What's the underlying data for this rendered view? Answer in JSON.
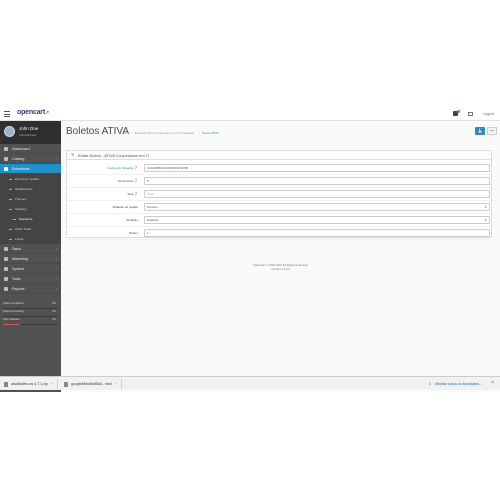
{
  "header": {
    "logo_text": "opencart",
    "logo_cart": "↗ ",
    "logout_label": "Logout"
  },
  "sidebar": {
    "user_name": "John Doe",
    "user_role": "Administrator",
    "menu": [
      {
        "label": "Dashboard",
        "icon": "dashboard-icon"
      },
      {
        "label": "Catalog",
        "icon": "tags-icon"
      },
      {
        "label": "Extensions",
        "icon": "puzzle-icon"
      }
    ],
    "submenu": [
      {
        "label": "Extension Installer"
      },
      {
        "label": "Modifications"
      },
      {
        "label": "Themes"
      },
      {
        "label": "Shipping"
      },
      {
        "label": "Payments"
      },
      {
        "label": "Order Totals"
      },
      {
        "label": "Feeds"
      }
    ],
    "menu2": [
      {
        "label": "Sales",
        "icon": "cart-icon"
      },
      {
        "label": "Marketing",
        "icon": "share-icon"
      },
      {
        "label": "System",
        "icon": "cog-icon"
      },
      {
        "label": "Tools",
        "icon": "wrench-icon"
      },
      {
        "label": "Reports",
        "icon": "bar-chart-icon"
      }
    ],
    "stats": [
      {
        "label": "Orders Completed",
        "pct": "0%",
        "value": 0,
        "color": "#5cb85c"
      },
      {
        "label": "Orders Processing",
        "pct": "0%",
        "value": 0,
        "color": "#f0ad4e"
      },
      {
        "label": "Other Statuses",
        "pct": "0%",
        "value": 0.3,
        "color": "#d9534f"
      }
    ]
  },
  "main": {
    "title": "Boletos ATIVA",
    "breadcrumb": [
      "Home",
      "/",
      "Extensão ATIVA Cooperados em TI (Unificadas)",
      "/",
      "Boleto ATIVA"
    ],
    "save_icon": "💾",
    "back_icon": "↩",
    "panel_title": "Editar Boleto - ATIVA Cooperados em TI",
    "fields": [
      {
        "label": "Código de Situação",
        "value": "1D4C9B8S3C4S9S3P4K0Z6B",
        "placeholder": false,
        "required": true,
        "type": "text"
      },
      {
        "label": "Vencimento",
        "value": "5",
        "placeholder": false,
        "required": false,
        "type": "text"
      },
      {
        "label": "Taxa",
        "value": "Taxa",
        "placeholder": true,
        "required": false,
        "type": "text"
      },
      {
        "label": "Situação do pedido",
        "value": "Pending",
        "placeholder": false,
        "required": false,
        "type": "select"
      },
      {
        "label": "Situação",
        "value": "Enabled",
        "placeholder": false,
        "required": false,
        "type": "select"
      },
      {
        "label": "Ordem",
        "value": "1",
        "placeholder": false,
        "required": false,
        "type": "text"
      }
    ],
    "footer_link": "OpenCart",
    "footer_text": " © 2009-2018 All Rights Reserved.",
    "footer_version": "Version 2.3.0.2"
  },
  "downloads": {
    "items": [
      {
        "name": "ativaBoleto.rar 2.7.1.zip"
      },
      {
        "name": "google4fbfc8b6f5d4 - html"
      }
    ],
    "show_all": "Mostrar todos os downloads..."
  }
}
